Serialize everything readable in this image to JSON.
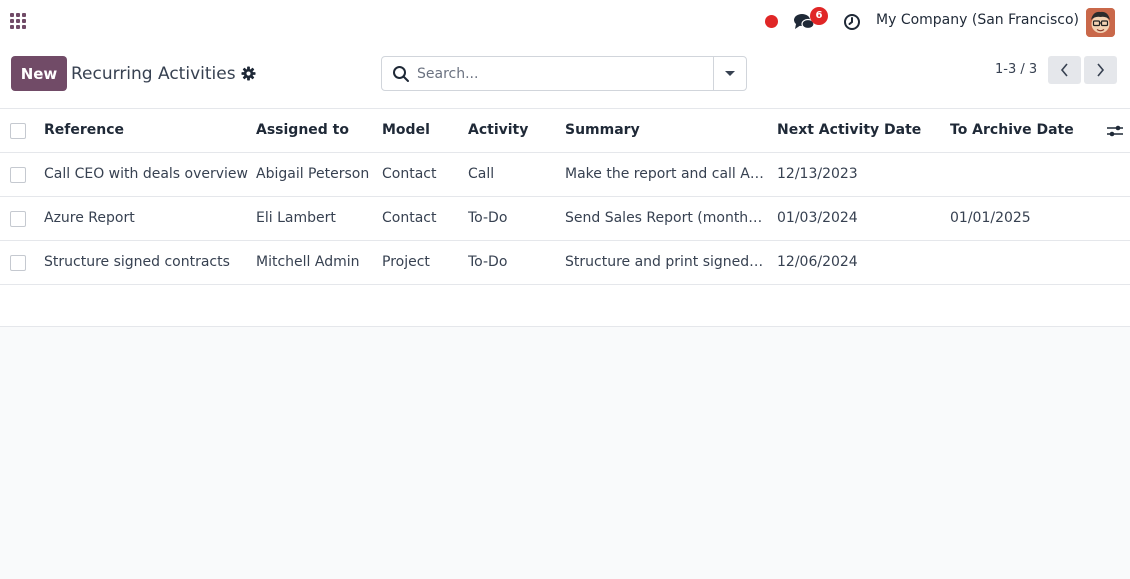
{
  "navbar": {
    "messages_count": "6",
    "company": "My Company (San Francisco)"
  },
  "control": {
    "new_label": "New",
    "title": "Recurring Activities",
    "search_placeholder": "Search...",
    "pager": "1-3 / 3"
  },
  "columns": {
    "reference": "Reference",
    "assigned_to": "Assigned to",
    "model": "Model",
    "activity": "Activity",
    "summary": "Summary",
    "next_activity_date": "Next Activity Date",
    "to_archive_date": "To Archive Date"
  },
  "rows": [
    {
      "reference": "Call CEO with deals overview",
      "assigned_to": "Abigail Peterson",
      "model": "Contact",
      "activity": "Call",
      "summary": "Make the report and call A…",
      "next_activity_date": "12/13/2023",
      "to_archive_date": ""
    },
    {
      "reference": "Azure Report",
      "assigned_to": "Eli Lambert",
      "model": "Contact",
      "activity": "To-Do",
      "summary": "Send Sales Report (monthly)",
      "next_activity_date": "01/03/2024",
      "to_archive_date": "01/01/2025"
    },
    {
      "reference": "Structure signed contracts",
      "assigned_to": "Mitchell Admin",
      "model": "Project",
      "activity": "To-Do",
      "summary": "Structure and print signed …",
      "next_activity_date": "12/06/2024",
      "to_archive_date": ""
    }
  ],
  "colors": {
    "brand": "#714b67",
    "badge": "#e02626"
  },
  "icons": [
    "apps-grid-icon",
    "recording-dot-icon",
    "chat-icon",
    "clock-icon",
    "avatar",
    "gear-icon",
    "search-icon",
    "caret-down-icon",
    "chevron-left-icon",
    "chevron-right-icon",
    "optional-columns-icon"
  ]
}
